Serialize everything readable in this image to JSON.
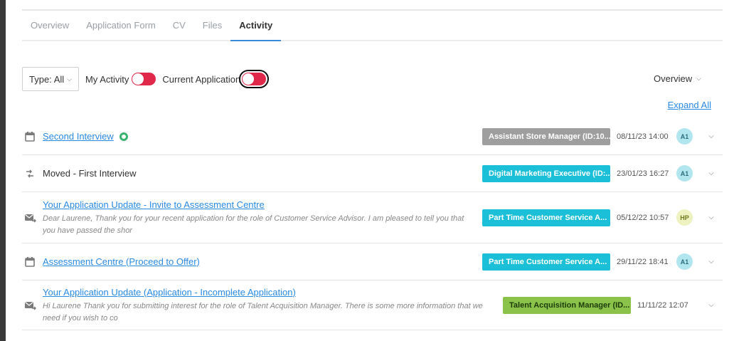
{
  "tabs": [
    {
      "label": "Overview"
    },
    {
      "label": "Application Form"
    },
    {
      "label": "CV"
    },
    {
      "label": "Files"
    },
    {
      "label": "Activity"
    }
  ],
  "active_tab": "Activity",
  "filters": {
    "type_label": "Type: All",
    "my_activity_label": "My Activity",
    "my_activity_on": true,
    "current_application_label": "Current Application",
    "current_application_on": true
  },
  "overview_dropdown": "Overview",
  "expand_all": "Expand All",
  "colors": {
    "accent_link": "#2b8ae2",
    "toggle_on": "#e0294a",
    "tag_grey": "#9e9e9e",
    "tag_cyan": "#1bbfd8",
    "tag_green": "#8bc34a",
    "status_green": "#3cb371"
  },
  "activities": [
    {
      "icon": "calendar-icon",
      "title": "Second Interview",
      "status_dot": true,
      "job_tag": "Assistant Store Manager (ID:10...",
      "timestamp": "08/11/23 14:00",
      "avatar": "A1"
    },
    {
      "icon": "move-arrows-icon",
      "title": "Moved - First Interview",
      "job_tag": "Digital Marketing Executive (ID:...",
      "timestamp": "23/01/23 16:27",
      "avatar": "A1"
    },
    {
      "icon": "email-forward-icon",
      "title": "Your Application Update - Invite to Assessment Centre",
      "desc_1": "Dear Laurene, Thank you for your recent application for the role of Customer Service Advisor. I am pleased to tell you that",
      "desc_2": "you have passed the shor",
      "job_tag": "Part Time Customer Service A...",
      "timestamp": "05/12/22 10:57",
      "avatar": "HP"
    },
    {
      "icon": "calendar-icon",
      "title": "Assessment Centre (Proceed to Offer)",
      "job_tag": "Part Time Customer Service A...",
      "timestamp": "29/11/22 18:41",
      "avatar": "A1"
    },
    {
      "icon": "email-forward-icon",
      "title": "Your Application Update (Application - Incomplete Application)",
      "desc_1": "Hi Laurene Thank you for submitting interest for the role of Talent Acquisition Manager. There is some more information that we",
      "desc_2": "need if you wish to co",
      "job_tag": "Talent Acquisition Manager (ID...",
      "timestamp": "11/11/22 12:07"
    }
  ]
}
